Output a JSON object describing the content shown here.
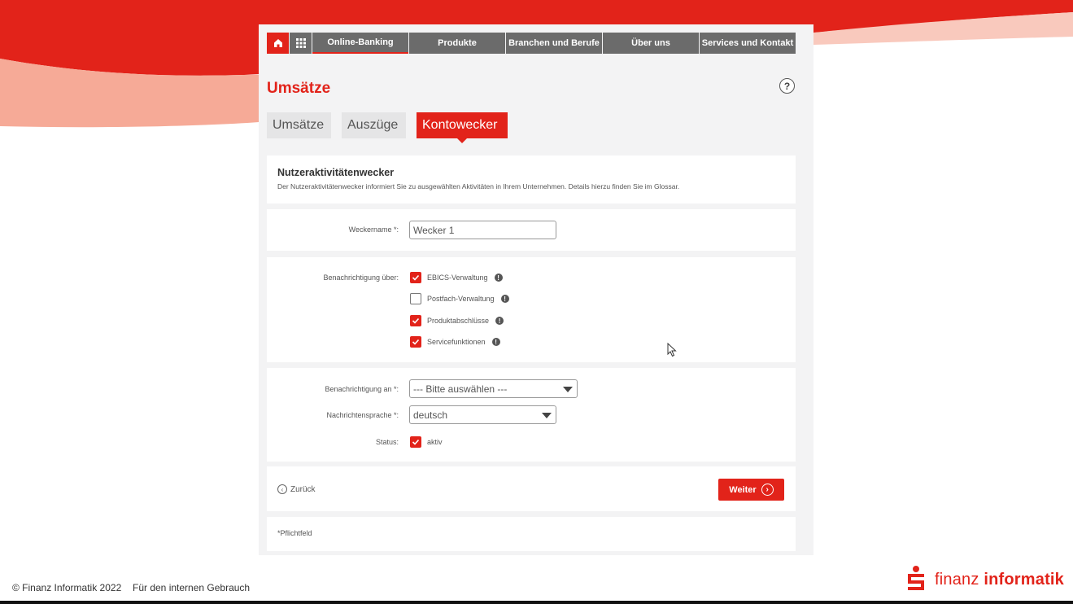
{
  "nav": {
    "items": [
      {
        "label": "Online-Banking",
        "active": true
      },
      {
        "label": "Produkte",
        "active": false
      },
      {
        "label": "Branchen und Berufe",
        "active": false
      },
      {
        "label": "Über uns",
        "active": false
      },
      {
        "label": "Services und Kontakt",
        "active": false
      }
    ]
  },
  "page": {
    "title": "Umsätze",
    "help_label": "?"
  },
  "tabs": [
    {
      "label": "Umsätze",
      "active": false
    },
    {
      "label": "Auszüge",
      "active": false
    },
    {
      "label": "Kontowecker",
      "active": true
    }
  ],
  "intro": {
    "heading": "Nutzeraktivitätenwecker",
    "description": "Der Nutzeraktivitätenwecker informiert Sie zu ausgewählten Aktivitäten in Ihrem Unternehmen. Details hierzu finden Sie im Glossar."
  },
  "form": {
    "weckername_label": "Weckername *:",
    "weckername_value": "Wecker 1",
    "benachrichtigung_ueber_label": "Benachrichtigung über:",
    "options": [
      {
        "label": "EBICS-Verwaltung",
        "checked": true
      },
      {
        "label": "Postfach-Verwaltung",
        "checked": false
      },
      {
        "label": "Produktabschlüsse",
        "checked": true
      },
      {
        "label": "Servicefunktionen",
        "checked": true
      }
    ],
    "benachrichtigung_an_label": "Benachrichtigung an *:",
    "benachrichtigung_an_value": "--- Bitte auswählen ---",
    "sprache_label": "Nachrichtensprache *:",
    "sprache_value": "deutsch",
    "status_label": "Status:",
    "status_value": "aktiv",
    "status_checked": true
  },
  "actions": {
    "back_label": "Zurück",
    "next_label": "Weiter"
  },
  "required_note": "*Pflichtfeld",
  "footer": {
    "copyright": "© Finanz Informatik 2022",
    "note": "Für den internen Gebrauch",
    "brand_light": "finanz ",
    "brand_bold": "informatik"
  },
  "colors": {
    "accent": "#e2231a",
    "nav_gray": "#6b6b6b",
    "panel": "#f3f3f4"
  }
}
